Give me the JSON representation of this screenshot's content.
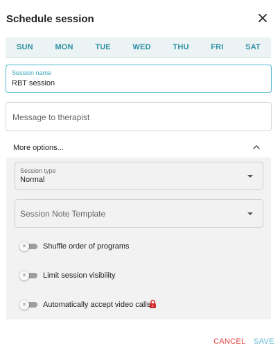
{
  "dialog": {
    "title": "Schedule session",
    "close_icon": "close-icon"
  },
  "days": [
    "SUN",
    "MON",
    "TUE",
    "WED",
    "THU",
    "FRI",
    "SAT"
  ],
  "session_name": {
    "label": "Session name",
    "value": "RBT session"
  },
  "message": {
    "placeholder": "Message to therapist",
    "value": ""
  },
  "more_options": {
    "label": "More options...",
    "expanded": true
  },
  "session_type": {
    "label": "Session type",
    "value": "Normal"
  },
  "note_template": {
    "placeholder": "Session Note Template"
  },
  "toggles": [
    {
      "label": "Shuffle order of programs",
      "on": false
    },
    {
      "label": "Limit session visibility",
      "on": false
    },
    {
      "label": "Automatically accept video calls",
      "on": false,
      "locked": true
    }
  ],
  "actions": {
    "cancel": "CANCEL",
    "save": "SAVE"
  },
  "colors": {
    "accent": "#2c8fa2",
    "focus": "#4ab8cc",
    "cancel": "#e53935",
    "save": "#5cb8d6",
    "lock": "#d32f2f"
  }
}
